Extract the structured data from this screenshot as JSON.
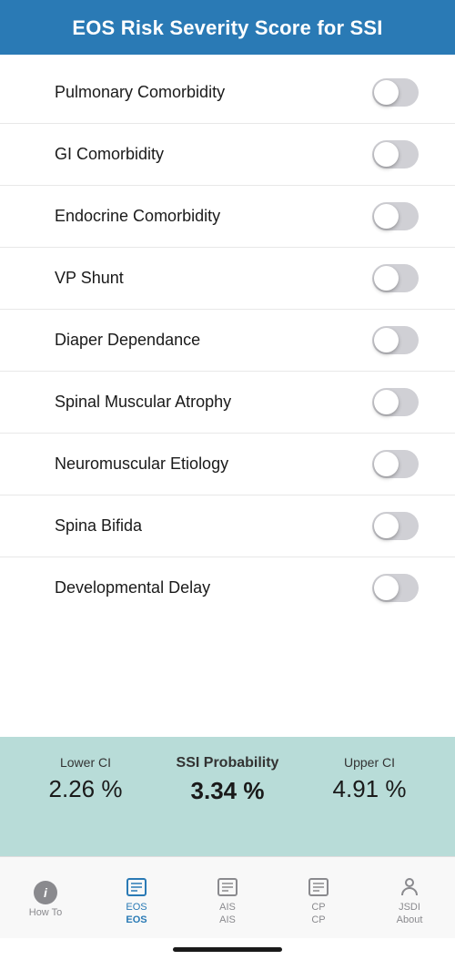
{
  "header": {
    "title": "EOS Risk Severity Score for SSI"
  },
  "toggles": [
    {
      "id": "pulmonary",
      "label": "Pulmonary Comorbidity",
      "checked": false
    },
    {
      "id": "gi",
      "label": "GI Comorbidity",
      "checked": false
    },
    {
      "id": "endocrine",
      "label": "Endocrine Comorbidity",
      "checked": false
    },
    {
      "id": "vp_shunt",
      "label": "VP Shunt",
      "checked": false
    },
    {
      "id": "diaper",
      "label": "Diaper Dependance",
      "checked": false
    },
    {
      "id": "spinal_muscular",
      "label": "Spinal Muscular Atrophy",
      "checked": false
    },
    {
      "id": "neuromuscular",
      "label": "Neuromuscular Etiology",
      "checked": false
    },
    {
      "id": "spina_bifida",
      "label": "Spina Bifida",
      "checked": false
    },
    {
      "id": "developmental",
      "label": "Developmental Delay",
      "checked": false
    }
  ],
  "results": {
    "lower_ci_label": "Lower CI",
    "lower_ci_value": "2.26 %",
    "ssi_label": "SSI Probability",
    "ssi_value": "3.34 %",
    "upper_ci_label": "Upper CI",
    "upper_ci_value": "4.91 %"
  },
  "nav": {
    "items": [
      {
        "id": "how_to",
        "top_label": "How To",
        "bottom_label": "",
        "active": false
      },
      {
        "id": "eos",
        "top_label": "EOS",
        "bottom_label": "EOS",
        "active": true
      },
      {
        "id": "ais",
        "top_label": "AIS",
        "bottom_label": "AIS",
        "active": false
      },
      {
        "id": "cp",
        "top_label": "CP",
        "bottom_label": "CP",
        "active": false
      },
      {
        "id": "jsdi",
        "top_label": "JSDI",
        "bottom_label": "About",
        "active": false
      }
    ]
  }
}
